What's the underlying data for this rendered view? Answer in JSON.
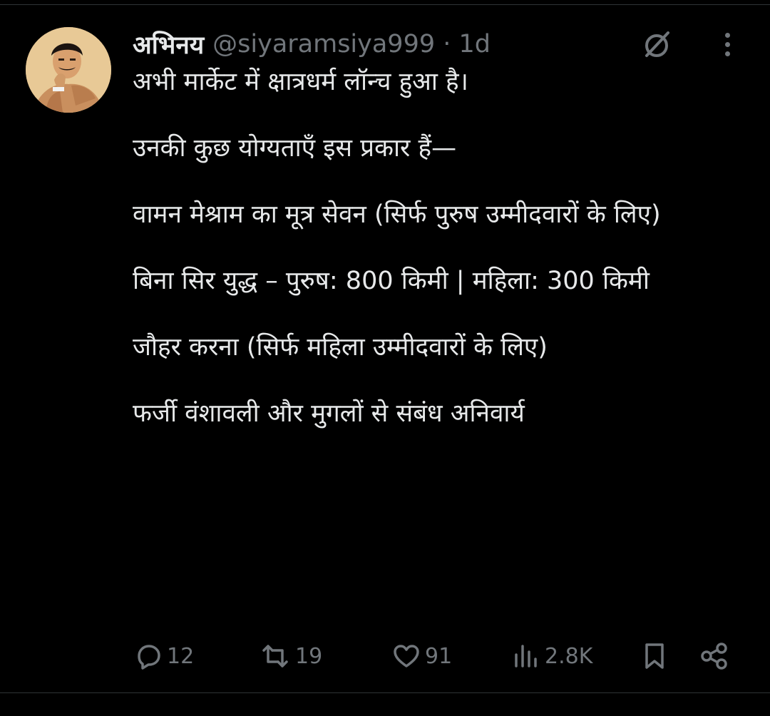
{
  "tweet": {
    "display_name": "अभिनय",
    "handle_time": "@siyaramsiya999 · 1d",
    "paragraphs": [
      "अभी मार्केट में क्षात्रधर्म लॉन्च हुआ है।",
      "उनकी कुछ योग्यताएँ इस प्रकार हैं—",
      "वामन मेश्राम का मूत्र सेवन (सिर्फ पुरुष उम्मीदवारों के लिए)",
      "बिना सिर युद्ध – पुरुष: 800 किमी | महिला: 300 किमी",
      "जौहर करना (सिर्फ महिला उम्मीदवारों के लिए)",
      "फर्जी वंशावली और मुगलों से संबंध अनिवार्य"
    ],
    "stats": {
      "replies": "12",
      "retweets": "19",
      "likes": "91",
      "views": "2.8K"
    }
  },
  "icons": {
    "grok": "grok-icon",
    "more": "more-options-icon",
    "reply": "reply-icon",
    "retweet": "retweet-icon",
    "like": "heart-icon",
    "views": "views-icon",
    "bookmark": "bookmark-icon",
    "share": "share-icon"
  },
  "colors": {
    "background": "#000000",
    "text": "#e7e9ea",
    "muted": "#71767b"
  }
}
